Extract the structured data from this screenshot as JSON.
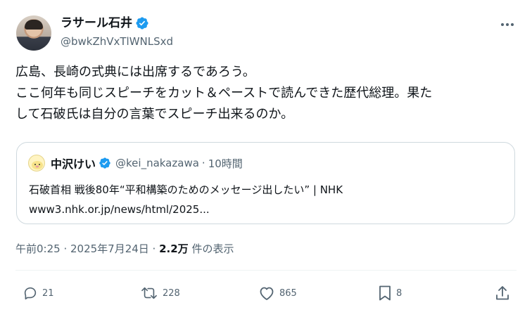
{
  "author": {
    "name": "ラサール石井",
    "handle": "@bwkZhVxTlWNLSxd"
  },
  "text": "広島、長崎の式典には出席するであろう。\nここ何年も同じスピーチをカット＆ペーストで読んできた歴代総理。果た\nして石破氏は自分の言葉でスピーチ出来るのか。",
  "quote": {
    "name": "中沢けい",
    "handle": "@kei_nakazawa",
    "time": "10時間",
    "title": "石破首相 戦後80年“平和構築のためのメッセージ出したい” | NHK",
    "url": "www3.nhk.or.jp/news/html/2025..."
  },
  "meta": {
    "time": "午前0:25 · 2025年7月24日 · ",
    "views_count": "2.2万",
    "views_label": " 件の表示"
  },
  "actions": {
    "replies": "21",
    "reposts": "228",
    "likes": "865",
    "bookmarks": "8"
  },
  "colors": {
    "verified": "#1d9bf0",
    "secondary_text": "#536471",
    "border": "#cfd9de"
  },
  "icons": [
    "verified-badge-icon",
    "more-icon",
    "reply-icon",
    "repost-icon",
    "like-icon",
    "bookmark-icon",
    "share-icon"
  ]
}
